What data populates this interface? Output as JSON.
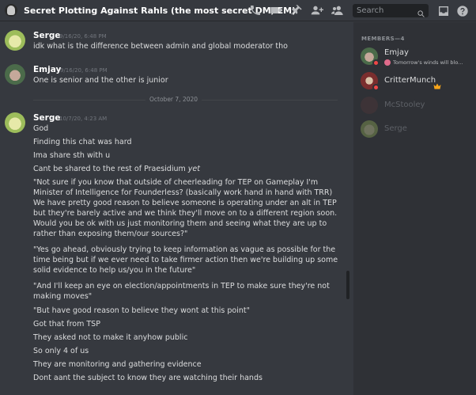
{
  "header": {
    "title": "Secret Plotting Against Rahls (the most secret DM, EM)",
    "search_placeholder": "Search"
  },
  "messages": [
    {
      "author": "Serge",
      "timestamp": "9/16/20, 6:48 PM",
      "lines": [
        "idk what is the difference between admin and global moderator tho"
      ]
    },
    {
      "author": "Emjay",
      "timestamp": "9/16/20, 6:48 PM",
      "lines": [
        "One is senior and the other is junior"
      ]
    },
    {
      "author": "Serge",
      "timestamp": "10/7/20, 4:23 AM",
      "lines": [
        "God",
        "Finding this chat was hard",
        "Ima share sth with u",
        "Cant be shared to the rest of Praesidium",
        "yet",
        "\"Not sure if you know that outside of cheerleading for TEP on Gameplay I'm",
        "Minister of Intelligence for Founderless? (basically work hand in hand with TRR)",
        "We have pretty good reason to believe someone is operating under an alt in TEP",
        "but they're barely active and we think they'll move on to a different region soon.",
        "Would you be ok with us just monitoring them and seeing what they are up to",
        "rather than exposing them/our sources?\"",
        "\"Yes go ahead, obviously trying to keep information as vague as possible for the",
        "time being but if we ever need to take firmer action then we're building up some",
        "solid evidence to help us/you in the future\"",
        "\"And I'll keep an eye on election/appointments in TEP to make sure they're not",
        "making moves\"",
        "\"But have good reason to believe they wont at this point\"",
        "Got that from TSP",
        "They asked not to make it anyhow public",
        "So only 4 of us",
        "They are monitoring and gathering evidence",
        "Dont aant the subject to know they are watching their hands"
      ]
    }
  ],
  "divider_label": "October 7, 2020",
  "members": {
    "header": "MEMBERS—4",
    "list": [
      {
        "name": "Emjay",
        "status": "Tomorrow's winds will blo..."
      },
      {
        "name": "CritterMunch"
      },
      {
        "name": "McStooley"
      },
      {
        "name": "Serge"
      }
    ]
  },
  "icons": [
    "phone-icon",
    "video-icon",
    "pin-icon",
    "add-member-icon",
    "members-icon",
    "search-icon",
    "inbox-icon",
    "help-icon",
    "crown-icon"
  ],
  "colors": {
    "background": "#36393f",
    "sidebar": "#2f3136",
    "dnd_status": "#f04747",
    "owner_crown": "#faa61a"
  }
}
